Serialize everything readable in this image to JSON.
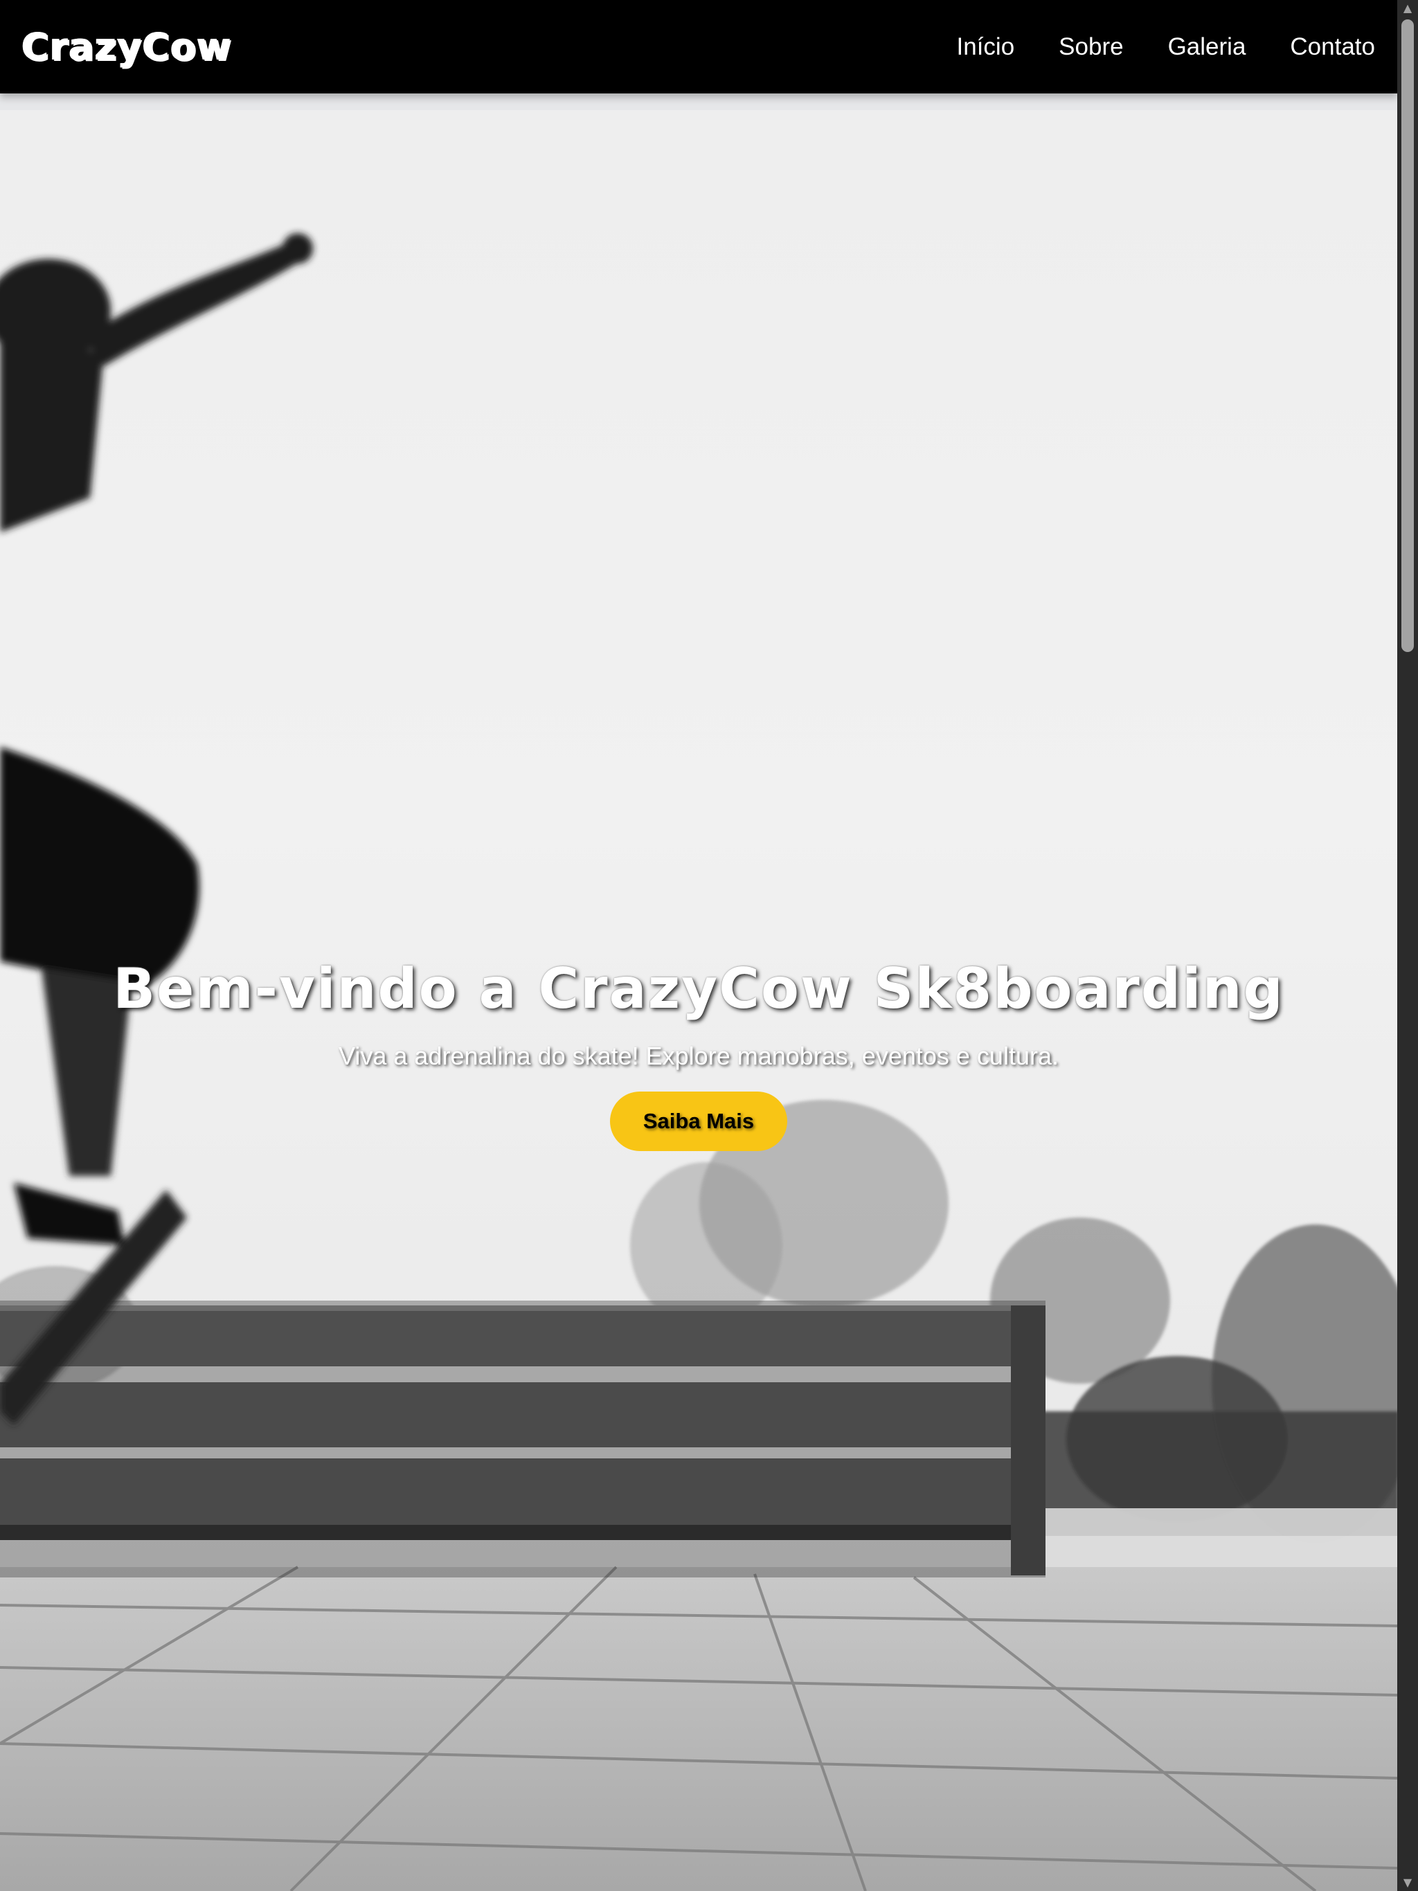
{
  "header": {
    "logo": "CrazyCow",
    "nav": [
      {
        "label": "Início"
      },
      {
        "label": "Sobre"
      },
      {
        "label": "Galeria"
      },
      {
        "label": "Contato"
      }
    ]
  },
  "hero": {
    "title": "Bem-vindo a CrazyCow Sk8boarding",
    "subtitle": "Viva a adrenalina do skate! Explore manobras, eventos e cultura.",
    "cta_label": "Saiba Mais",
    "background_image": "black-and-white photo of a skateboarder jumping over a wooden bench"
  },
  "colors": {
    "header_bg": "#000000",
    "accent": "#f8c515",
    "text_light": "#ffffff"
  },
  "icons": {
    "scroll_up": "scroll-up-arrow-icon",
    "scroll_down": "scroll-down-arrow-icon"
  }
}
